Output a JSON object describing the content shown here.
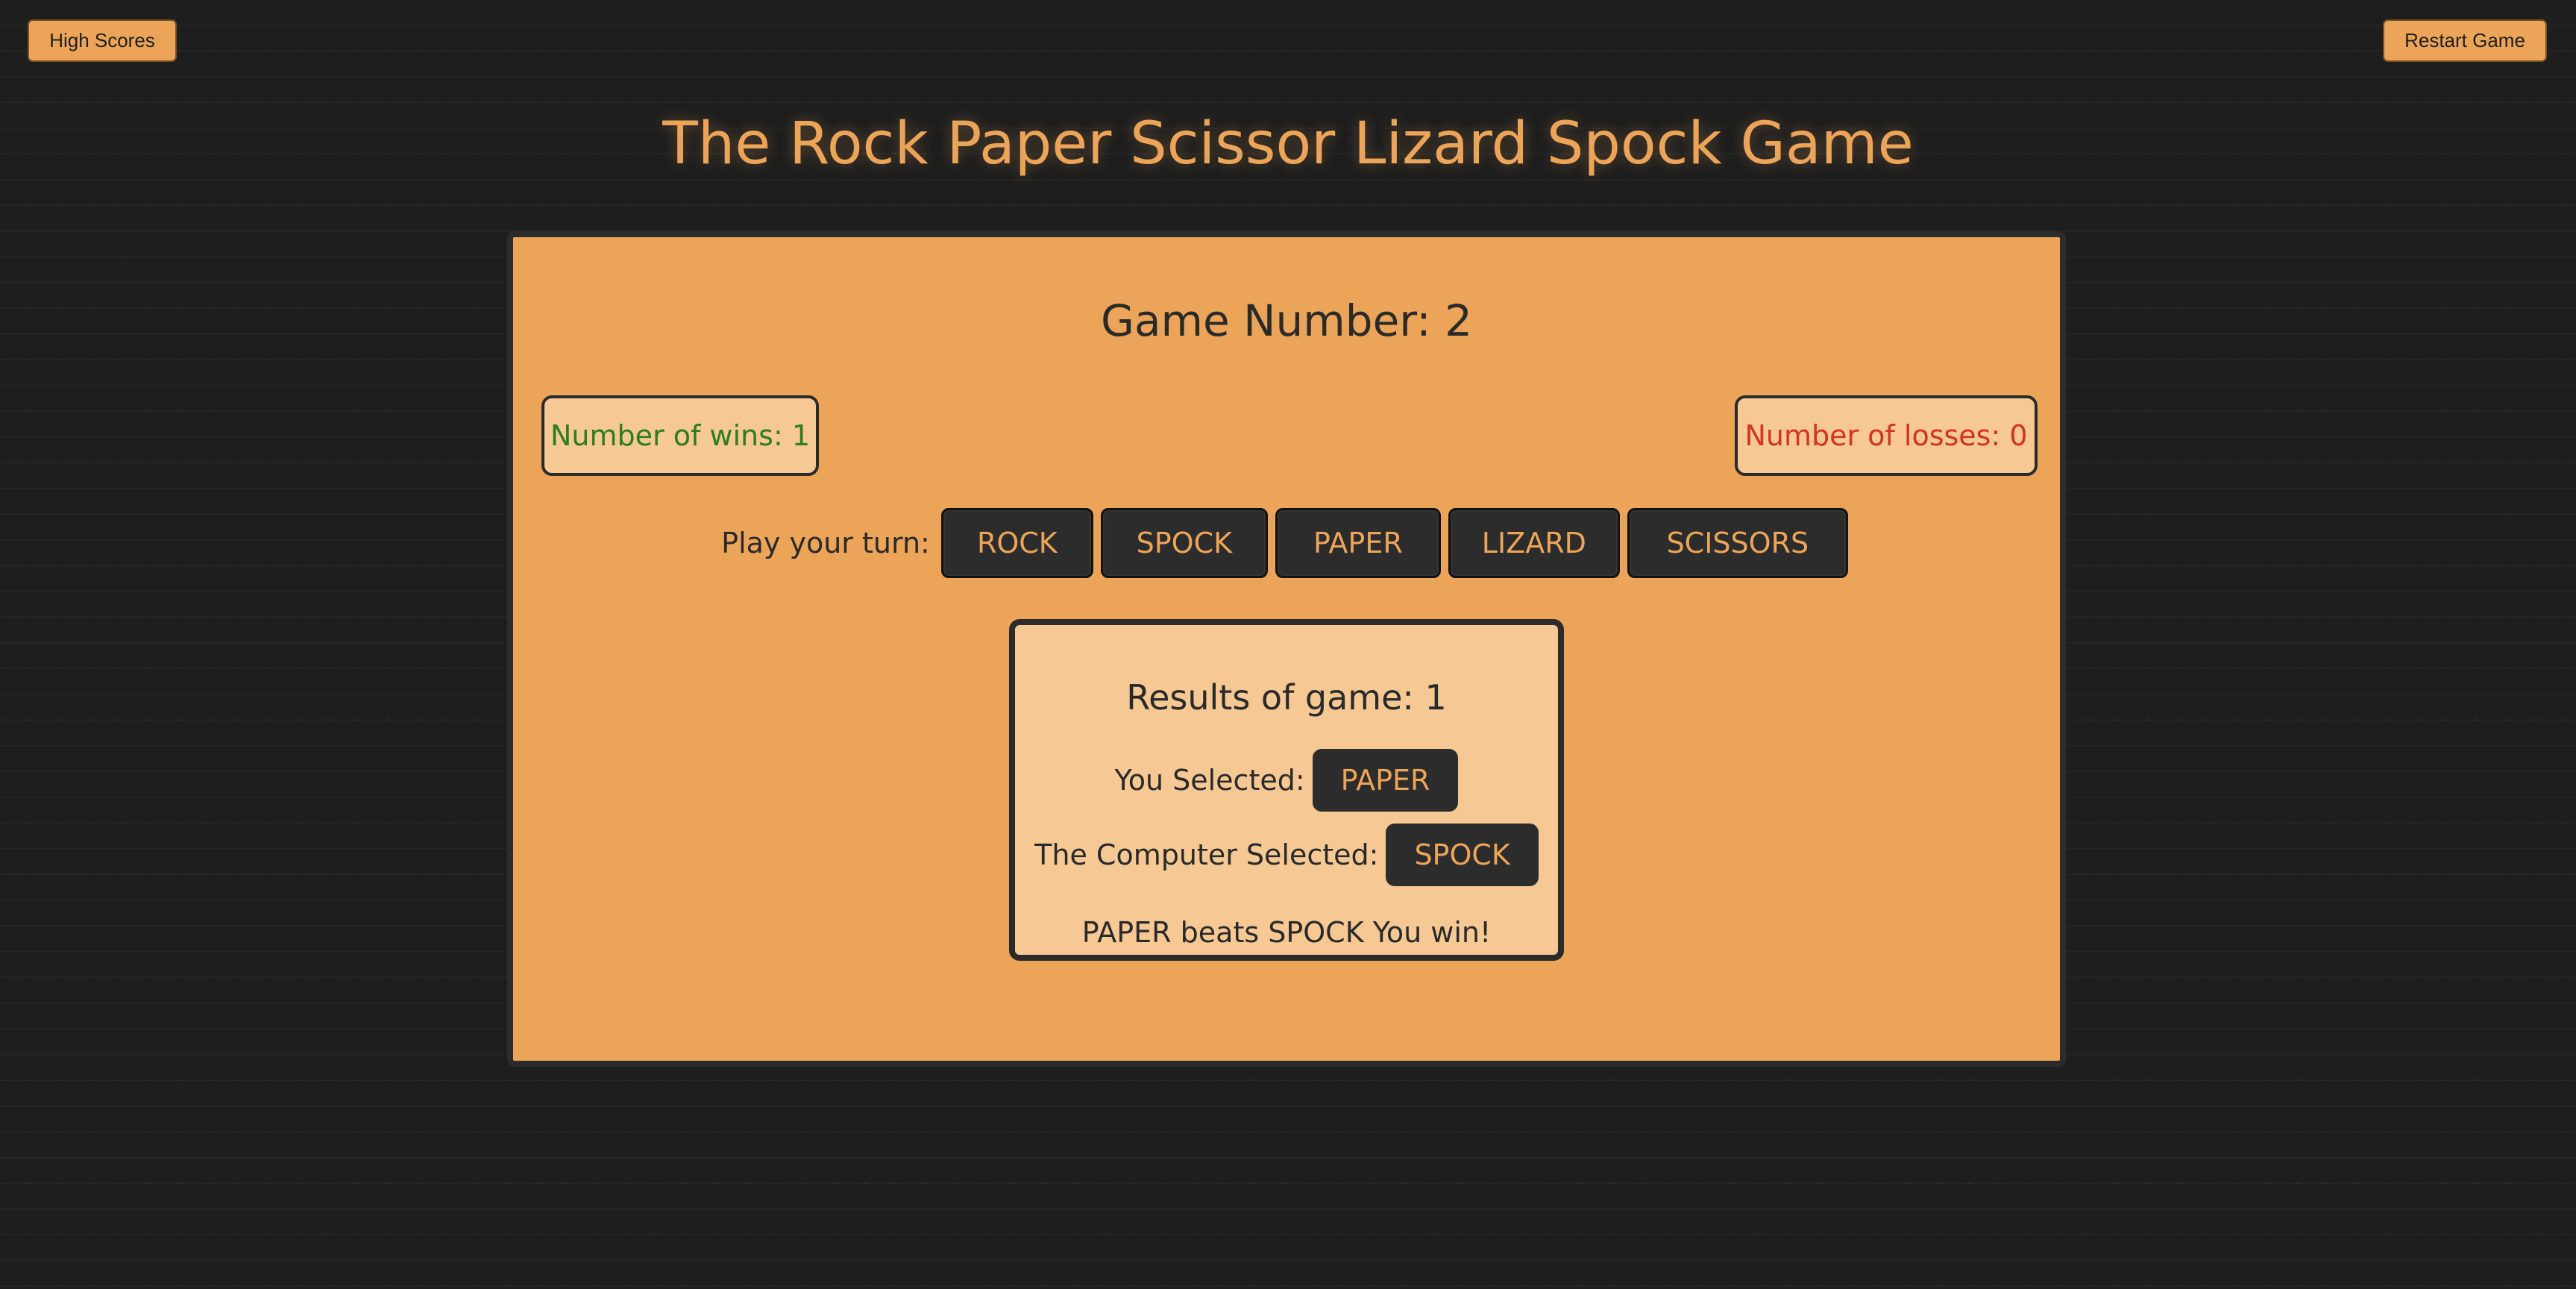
{
  "header": {
    "high_scores_label": "High Scores",
    "restart_label": "Restart Game",
    "title": "The Rock Paper Scissor Lizard Spock Game"
  },
  "game": {
    "game_number_text": "Game Number: 2",
    "wins_text": "Number of wins: 1",
    "losses_text": "Number of losses: 0"
  },
  "play": {
    "label": "Play your turn:",
    "choices": [
      "ROCK",
      "SPOCK",
      "PAPER",
      "LIZARD",
      "SCISSORS"
    ]
  },
  "results": {
    "title": "Results of game: 1",
    "you_selected_label": "You Selected:",
    "you_selected_value": "PAPER",
    "computer_selected_label": "The Computer Selected:",
    "computer_selected_value": "SPOCK",
    "outcome": "PAPER beats SPOCK You win!"
  },
  "colors": {
    "accent": "#eca558",
    "panel_light": "#f5c894",
    "dark": "#2c2c2c",
    "win": "#2e7d1f",
    "loss": "#d63225"
  }
}
